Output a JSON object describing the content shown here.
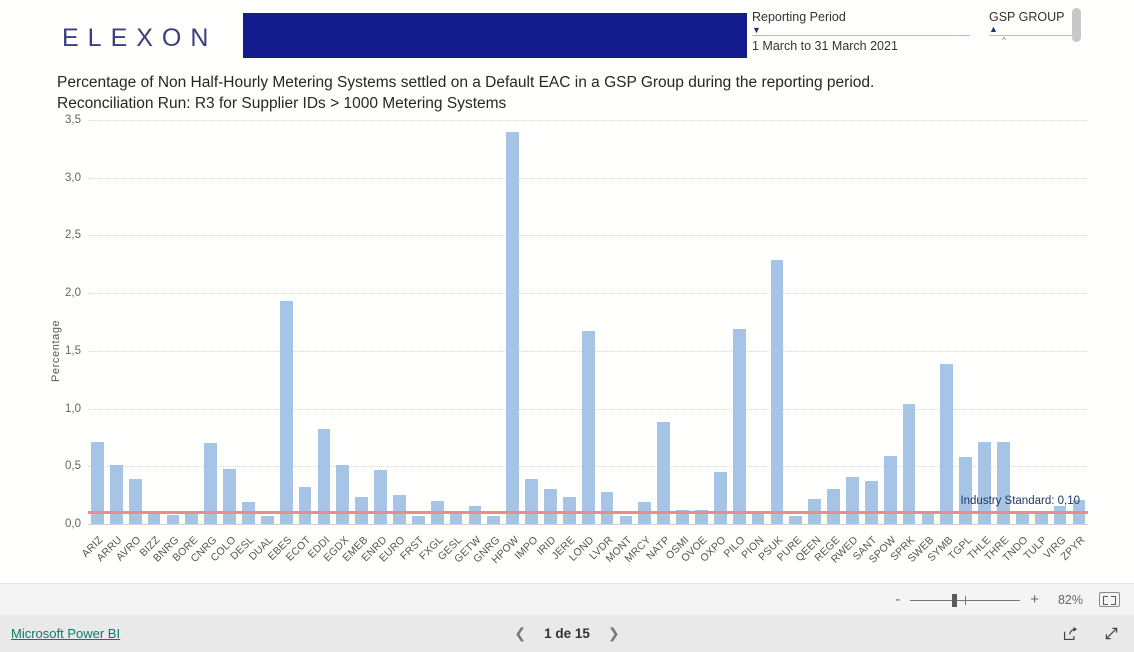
{
  "header": {
    "logo_text": "ELEXON",
    "band_color": "#141b8c",
    "reporting_period": {
      "label": "Reporting Period",
      "value": "1 March to 31 March 2021",
      "caret_icon": "chevron-down-icon"
    },
    "gsp_group": {
      "label": "GSP GROUP",
      "caret_icon": "chevron-up-icon",
      "caret_small": "^"
    }
  },
  "titles": {
    "line1": "Percentage of Non Half-Hourly Metering Systems settled on a Default EAC in a GSP Group during the reporting period.",
    "line2": "Reconciliation Run: R3 for Supplier IDs > 1000 Metering Systems"
  },
  "annotation": {
    "industry_standard_label": "Industry Standard: 0,10",
    "industry_standard_value": 0.1,
    "line_color": "#ef8a8a"
  },
  "footer": {
    "zoom": {
      "minus": "-",
      "plus": "+",
      "percent": "82%",
      "fit_icon": "fit-to-page-icon"
    },
    "powerbi_link": "Microsoft Power BI",
    "pager": {
      "prev_icon": "chevron-left-icon",
      "next_icon": "chevron-right-icon",
      "text": "1 de 15"
    },
    "share_icon": "share-icon",
    "fullscreen_icon": "fullscreen-icon"
  },
  "chart_data": {
    "type": "bar",
    "title": "Percentage of Non Half-Hourly Metering Systems settled on a Default EAC in a GSP Group during the reporting period.",
    "subtitle": "Reconciliation Run: R3 for Supplier IDs > 1000 Metering Systems",
    "xlabel": "",
    "ylabel": "Percentage",
    "ylim": [
      0,
      3.5
    ],
    "yticks": [
      0.0,
      0.5,
      1.0,
      1.5,
      2.0,
      2.5,
      3.0,
      3.5
    ],
    "ytick_labels": [
      "0,0",
      "0,5",
      "1,0",
      "1,5",
      "2,0",
      "2,5",
      "3,0",
      "3,5"
    ],
    "grid": true,
    "legend": "none",
    "bar_color": "#a5c4e6",
    "reference_line": {
      "label": "Industry Standard: 0,10",
      "value": 0.1,
      "color": "#ef8a8a"
    },
    "categories": [
      "ARIZ",
      "ARRU",
      "AVRO",
      "BIZZ",
      "BNRG",
      "BORE",
      "CNRG",
      "COLO",
      "DESL",
      "DUAL",
      "EBES",
      "ECOT",
      "EDDI",
      "EGDX",
      "EMEB",
      "ENRD",
      "EURO",
      "FRST",
      "FXGL",
      "GESL",
      "GETW",
      "GNRG",
      "HPOW",
      "IMPO",
      "IRID",
      "JERE",
      "LOND",
      "LVDR",
      "MONT",
      "MRCY",
      "NATP",
      "OSMI",
      "OVOE",
      "OXPO",
      "PILO",
      "PION",
      "PSUK",
      "PURE",
      "QEEN",
      "REGE",
      "RWED",
      "SANT",
      "SPOW",
      "SPRK",
      "SWEB",
      "SYMB",
      "TGPL",
      "THLE",
      "THRE",
      "TNDO",
      "TULP",
      "VIRG",
      "ZPYR"
    ],
    "values": [
      0.71,
      0.51,
      0.39,
      0.09,
      0.08,
      0.11,
      0.7,
      0.48,
      0.19,
      0.07,
      1.93,
      0.32,
      0.82,
      0.51,
      0.23,
      0.47,
      0.25,
      0.07,
      0.2,
      0.1,
      0.16,
      0.07,
      3.4,
      0.39,
      0.3,
      0.23,
      1.67,
      0.28,
      0.07,
      0.19,
      0.88,
      0.12,
      0.12,
      0.45,
      1.69,
      0.09,
      2.29,
      0.07,
      0.22,
      0.3,
      0.41,
      0.37,
      0.59,
      1.04,
      0.09,
      1.39,
      0.58,
      0.71,
      0.71,
      0.1,
      0.09,
      0.16,
      0.21
    ]
  }
}
